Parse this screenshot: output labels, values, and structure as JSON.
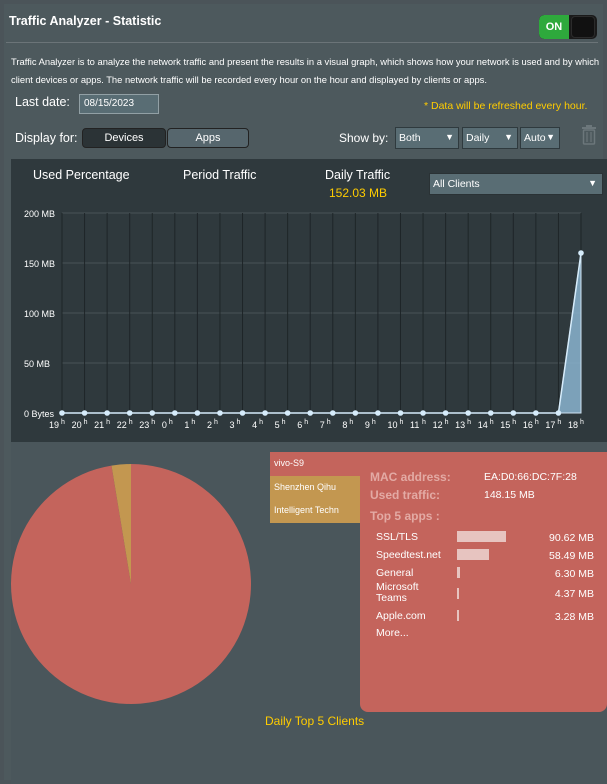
{
  "header": {
    "title": "Traffic Analyzer - Statistic",
    "toggle_label": "ON"
  },
  "description": "Traffic Analyzer is to analyze the network traffic and present the results in a visual graph, which shows how your network is used and by which client devices or apps. The network traffic will be recorded every hour on the hour and displayed by clients or apps.",
  "last_date": {
    "label": "Last date:",
    "value": "08/15/2023"
  },
  "refresh_note": "* Data will be refreshed every hour.",
  "display_for": {
    "label": "Display for:",
    "options": [
      "Devices",
      "Apps"
    ],
    "selected": "Devices"
  },
  "show_by": {
    "label": "Show by:",
    "direction": "Both",
    "period": "Daily",
    "scale": "Auto"
  },
  "colors": {
    "accent_yellow": "#ffcc00",
    "toggle_on": "#2ea93c",
    "pie_main": "#c4645c",
    "pie_second": "#c39750",
    "area_fill": "#8ab4cf"
  },
  "chart_tabs": {
    "used_percentage": "Used Percentage",
    "period_traffic": "Period Traffic",
    "daily_traffic": "Daily Traffic",
    "daily_traffic_value": "152.03 MB"
  },
  "client_filter": "All Clients",
  "chart_data": {
    "type": "area",
    "x": [
      "19",
      "20",
      "21",
      "22",
      "23",
      "0",
      "1",
      "2",
      "3",
      "4",
      "5",
      "6",
      "7",
      "8",
      "9",
      "10",
      "11",
      "12",
      "13",
      "14",
      "15",
      "16",
      "17",
      "18"
    ],
    "x_unit": "h",
    "values": [
      0,
      0,
      0,
      0,
      0,
      0,
      0,
      0,
      0,
      0,
      0,
      0,
      0,
      0,
      0,
      0,
      0,
      0,
      0,
      0,
      0,
      0,
      0,
      160
    ],
    "y_unit": "MB",
    "y_ticks": [
      "0 Bytes",
      "50 MB",
      "100 MB",
      "150 MB",
      "200 MB"
    ],
    "ylim": [
      0,
      200
    ],
    "grid": true
  },
  "pie": {
    "caption": "Daily Top 5 Clients",
    "clients": [
      "vivo-S9",
      "Shenzhen Qihu",
      "Intelligent Techn"
    ],
    "shares": [
      0.974,
      0.026
    ]
  },
  "detail": {
    "mac_label": "MAC address:",
    "mac_value": "EA:D0:66:DC:7F:28",
    "used_label": "Used traffic:",
    "used_value": "148.15 MB",
    "top_apps_label": "Top 5 apps :",
    "apps": [
      {
        "name": "SSL/TLS",
        "value": "90.62 MB",
        "share": 0.612
      },
      {
        "name": "Speedtest.net",
        "value": "58.49 MB",
        "share": 0.395
      },
      {
        "name": "General",
        "value": "6.30 MB",
        "share": 0.043
      },
      {
        "name": "Microsoft Teams",
        "value": "4.37 MB",
        "share": 0.03
      },
      {
        "name": "Apple.com",
        "value": "3.28 MB",
        "share": 0.022
      }
    ],
    "more_label": "More..."
  }
}
